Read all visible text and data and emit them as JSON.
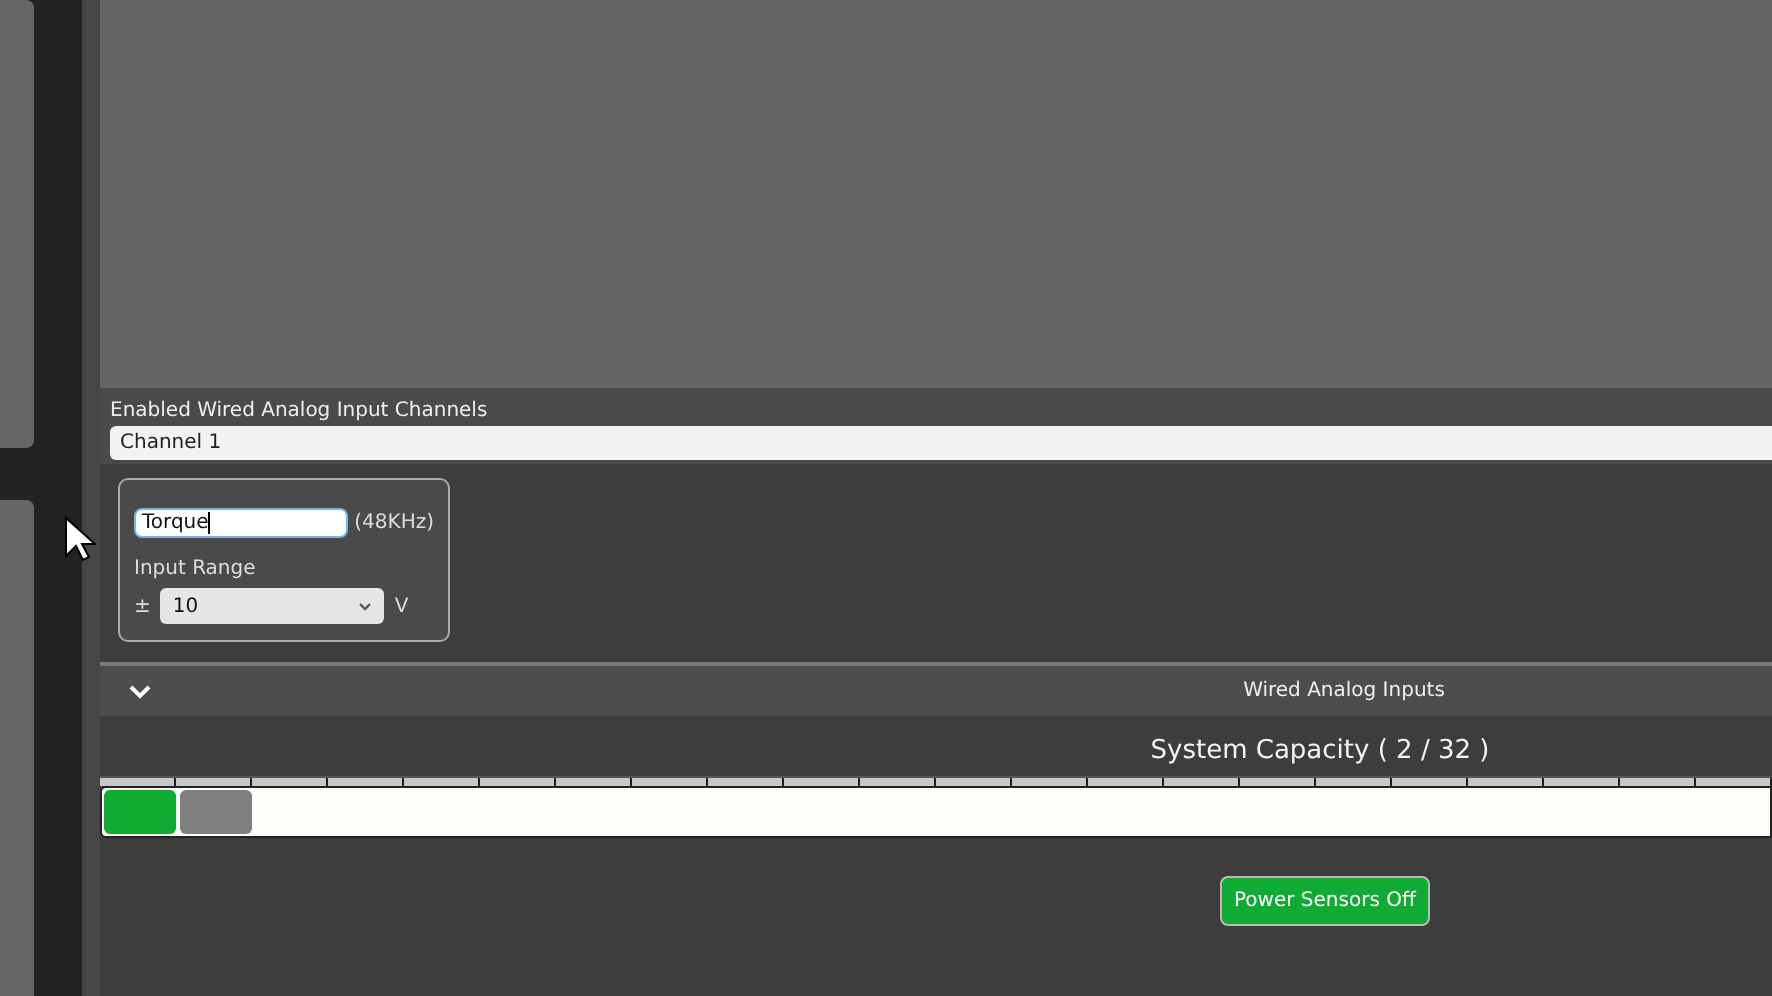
{
  "channels_label": "Enabled Wired Analog Input Channels",
  "channel_select": {
    "value": "Channel 1"
  },
  "channel_card": {
    "name_field": {
      "value": "Torque",
      "focused": true
    },
    "rate": "(48KHz)",
    "range_label": "Input Range",
    "plus_minus": "±",
    "range_select": {
      "value": "10"
    },
    "unit": "V"
  },
  "section": {
    "title": "Wired Analog Inputs",
    "expanded": true
  },
  "capacity": {
    "title": "System Capacity ( 2 / 32 )",
    "slots": [
      {
        "color": "#10ab33"
      },
      {
        "color": "#808080"
      }
    ]
  },
  "power_button": {
    "label": "Power Sensors Off"
  }
}
